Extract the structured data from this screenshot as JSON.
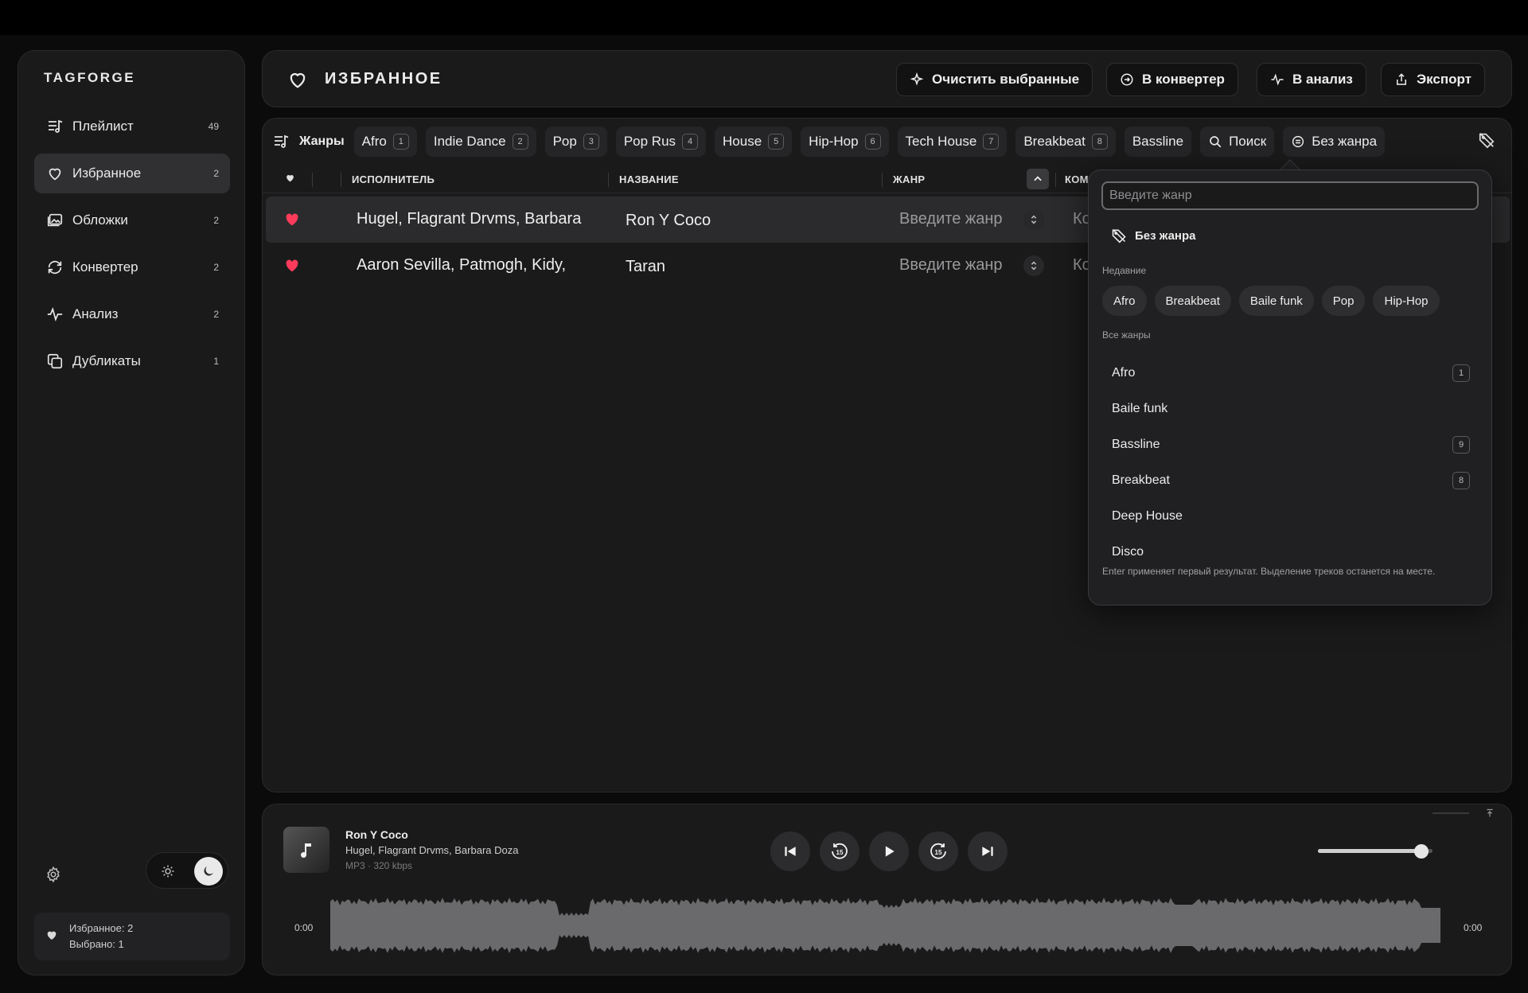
{
  "app": {
    "brand": "TAGFORGE"
  },
  "sidebar": {
    "items": [
      {
        "label": "Плейлист",
        "count": "49",
        "icon": "playlist-icon",
        "active": false
      },
      {
        "label": "Избранное",
        "count": "2",
        "icon": "heart-icon",
        "active": true
      },
      {
        "label": "Обложки",
        "count": "2",
        "icon": "image-icon",
        "active": false
      },
      {
        "label": "Конвертер",
        "count": "2",
        "icon": "refresh-icon",
        "active": false
      },
      {
        "label": "Анализ",
        "count": "2",
        "icon": "pulse-icon",
        "active": false
      },
      {
        "label": "Дубликаты",
        "count": "1",
        "icon": "copy-icon",
        "active": false
      }
    ],
    "status": {
      "favorites": "Избранное: 2",
      "selected": "Выбрано: 1"
    }
  },
  "header": {
    "title": "ИЗБРАННОЕ",
    "buttons": {
      "clear": "Очистить выбранные",
      "converter": "В конвертер",
      "analysis": "В анализ",
      "export": "Экспорт"
    }
  },
  "genres_bar": {
    "label": "Жанры",
    "chips": [
      {
        "label": "Afro",
        "count": "1"
      },
      {
        "label": "Indie Dance",
        "count": "2"
      },
      {
        "label": "Pop",
        "count": "3"
      },
      {
        "label": "Pop Rus",
        "count": "4"
      },
      {
        "label": "House",
        "count": "5"
      },
      {
        "label": "Hip-Hop",
        "count": "6"
      },
      {
        "label": "Tech House",
        "count": "7"
      },
      {
        "label": "Breakbeat",
        "count": "8"
      },
      {
        "label": "Bassline",
        "count": ""
      }
    ],
    "search": "Поиск",
    "no_genre": "Без жанра"
  },
  "table": {
    "columns": {
      "artist": "ИСПОЛНИТЕЛЬ",
      "title": "НАЗВАНИЕ",
      "genre": "ЖАНР",
      "comment": "КОМ"
    },
    "rows": [
      {
        "artist": "Hugel, Flagrant Drvms, Barbara",
        "title": "Ron Y Coco",
        "genre": "Введите жанр",
        "comment": "Ко",
        "selected": true
      },
      {
        "artist": "Aaron Sevilla, Patmogh, Kidy,",
        "title": "Taran",
        "genre": "Введите жанр",
        "comment": "Ко",
        "selected": false
      }
    ]
  },
  "genre_dropdown": {
    "placeholder": "Введите жанр",
    "no_genre": "Без жанра",
    "recent_label": "Недавние",
    "recent": [
      "Afro",
      "Breakbeat",
      "Baile funk",
      "Pop",
      "Hip-Hop"
    ],
    "all_label": "Все жанры",
    "all": [
      {
        "label": "Afro",
        "count": "1"
      },
      {
        "label": "Baile funk",
        "count": ""
      },
      {
        "label": "Bassline",
        "count": "9"
      },
      {
        "label": "Breakbeat",
        "count": "8"
      },
      {
        "label": "Deep House",
        "count": ""
      },
      {
        "label": "Disco",
        "count": ""
      }
    ],
    "hint": "Enter применяет первый результат. Выделение треков останется на месте."
  },
  "player": {
    "title": "Ron Y Coco",
    "artist": "Hugel, Flagrant Drvms, Barbara Doza",
    "format": "MP3 · 320 kbps",
    "time_current": "0:00",
    "time_total": "0:00",
    "volume": 0.9
  },
  "colors": {
    "accent_heart": "#ff3b5c",
    "background": "#0b0b0c",
    "panel": "#1a1a1b"
  }
}
